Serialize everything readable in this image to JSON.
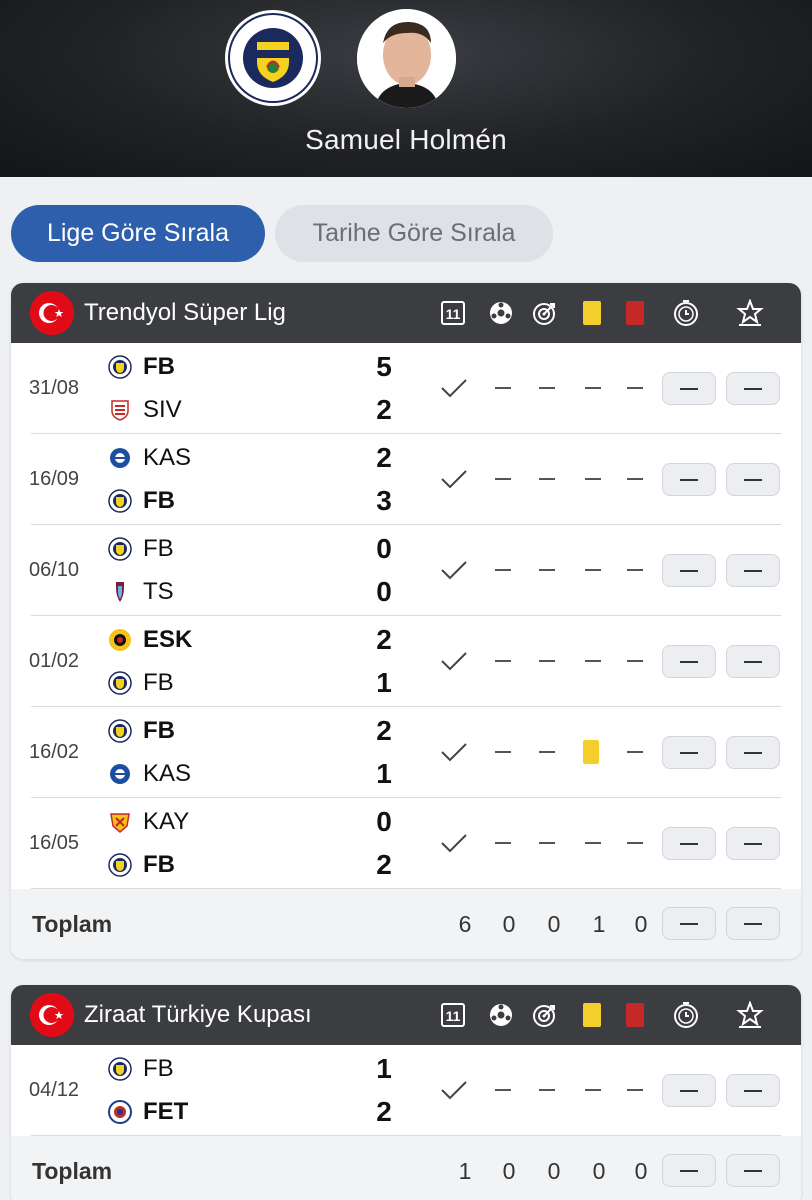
{
  "header": {
    "player_name": "Samuel Holmén",
    "club_logo_icon": "fenerbahce-crest-icon",
    "player_photo_icon": "player-photo"
  },
  "sort": {
    "active_label": "Lige Göre Sırala",
    "inactive_label": "Tarihe Göre Sırala"
  },
  "colors": {
    "accent": "#2e5fad",
    "header_bg": "#3b3d40",
    "yellow_card": "#f3ce2d",
    "red_card": "#c62828",
    "turkey_red": "#e30a17"
  },
  "column_icons": [
    "lineup-11-icon",
    "ball-goal-icon",
    "target-assist-icon",
    "yellow-card-icon",
    "red-card-icon",
    "minutes-clock-icon",
    "rating-star-icon"
  ],
  "leagues": [
    {
      "name": "Trendyol Süper Lig",
      "matches": [
        {
          "date": "31/08",
          "home": "FB",
          "home_bold": true,
          "away": "SIV",
          "away_bold": false,
          "home_score": "5",
          "away_score": "2",
          "yellow": false
        },
        {
          "date": "16/09",
          "home": "KAS",
          "home_bold": false,
          "away": "FB",
          "away_bold": true,
          "home_score": "2",
          "away_score": "3",
          "yellow": false
        },
        {
          "date": "06/10",
          "home": "FB",
          "home_bold": false,
          "away": "TS",
          "away_bold": false,
          "home_score": "0",
          "away_score": "0",
          "yellow": false
        },
        {
          "date": "01/02",
          "home": "ESK",
          "home_bold": true,
          "away": "FB",
          "away_bold": false,
          "home_score": "2",
          "away_score": "1",
          "yellow": false
        },
        {
          "date": "16/02",
          "home": "FB",
          "home_bold": true,
          "away": "KAS",
          "away_bold": false,
          "home_score": "2",
          "away_score": "1",
          "yellow": true
        },
        {
          "date": "16/05",
          "home": "KAY",
          "home_bold": false,
          "away": "FB",
          "away_bold": true,
          "home_score": "0",
          "away_score": "2",
          "yellow": false
        }
      ],
      "total": {
        "label": "Toplam",
        "values": [
          "6",
          "0",
          "0",
          "1",
          "0"
        ]
      }
    },
    {
      "name": "Ziraat Türkiye Kupası",
      "matches": [
        {
          "date": "04/12",
          "home": "FB",
          "home_bold": false,
          "away": "FET",
          "away_bold": true,
          "home_score": "1",
          "away_score": "2",
          "yellow": false
        }
      ],
      "total": {
        "label": "Toplam",
        "values": [
          "1",
          "0",
          "0",
          "0",
          "0"
        ]
      }
    }
  ]
}
